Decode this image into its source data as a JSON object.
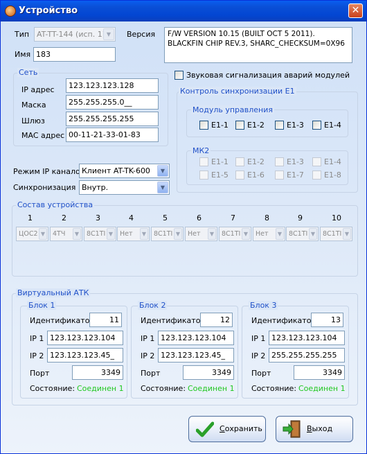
{
  "window": {
    "title": "Устройство",
    "close": "✕"
  },
  "type": {
    "label": "Тип",
    "value": "AT-TT-144 (исп. 1)"
  },
  "version": {
    "label": "Версия",
    "text": "F/W VERSION 10.15 (BUILT OCT  5 2011). BLACKFIN CHIP REV.3, SHARC_CHECKSUM=0X96"
  },
  "name": {
    "label": "Имя",
    "value": "183"
  },
  "network": {
    "title": "Сеть",
    "ip_label": "IP адрес",
    "ip": "123.123.123.128",
    "mask_label": "Маска",
    "mask": "255.255.255.0__",
    "gw_label": "Шлюз",
    "gw": "255.255.255.255",
    "mac_label": "MAC адрес",
    "mac": "00-11-21-33-01-83"
  },
  "alarm": {
    "label": "Звуковая сигнализация аварий модулей"
  },
  "sync_control": {
    "title": "Контроль синхронизации E1",
    "module_title": "Модуль управления",
    "module_items": [
      "E1-1",
      "E1-2",
      "E1-3",
      "E1-4"
    ],
    "mk2_title": "МК2",
    "mk2_items": [
      "E1-1",
      "E1-2",
      "E1-3",
      "E1-4",
      "E1-5",
      "E1-6",
      "E1-7",
      "E1-8"
    ]
  },
  "ip_mode": {
    "label": "Режим IP каналов",
    "value": "Клиент AT-TK-600"
  },
  "sync": {
    "label": "Синхронизация",
    "value": "Внутр."
  },
  "composition": {
    "title": "Состав устройства",
    "columns": [
      "1",
      "2",
      "3",
      "4",
      "5",
      "6",
      "7",
      "8",
      "9",
      "10"
    ],
    "slots": [
      "ЦОС2",
      "4ТЧ",
      "8С1ТІ",
      "Нет",
      "8С1ТІ",
      "Нет",
      "8С1ТІ",
      "Нет",
      "8С1ТІ",
      "8С1ТІ"
    ]
  },
  "vatk": {
    "title": "Виртуальный АТК",
    "id_label": "Идентификатор",
    "ip1_label": "IP 1",
    "ip2_label": "IP 2",
    "port_label": "Порт",
    "state_label": "Состояние:",
    "blocks": [
      {
        "title": "Блок 1",
        "id": "11",
        "ip1": "123.123.123.104",
        "ip2": "123.123.123.45_",
        "port": "3349",
        "state": "Соединен 1"
      },
      {
        "title": "Блок 2",
        "id": "12",
        "ip1": "123.123.123.104",
        "ip2": "123.123.123.45_",
        "port": "3349",
        "state": "Соединен 1"
      },
      {
        "title": "Блок 3",
        "id": "13",
        "ip1": "123.123.123.104",
        "ip2": "255.255.255.255",
        "port": "3349",
        "state": "Соединен 1"
      }
    ],
    "state_color": "#1fc71f"
  },
  "buttons": {
    "save": "Сохранить",
    "save_hotkey": "С",
    "save_rest": "охранить",
    "exit": "Выход",
    "exit_hotkey": "В",
    "exit_rest": "ыход"
  },
  "colors": {
    "title_bar": "#0346d2",
    "group_label": "#1f50c8",
    "ok_state": "#1fc71f"
  }
}
